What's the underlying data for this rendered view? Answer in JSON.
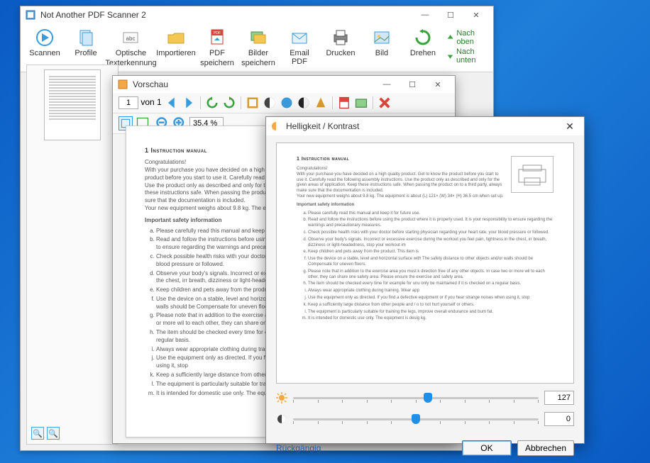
{
  "app": {
    "title": "Not Another PDF Scanner 2",
    "window_buttons": {
      "minimize": "—",
      "maximize": "☐",
      "close": "✕"
    }
  },
  "toolbar": {
    "scan": "Scannen",
    "profiles": "Profile",
    "ocr_line1": "Optische",
    "ocr_line2": "Texterkennung",
    "import": "Importieren",
    "pdf_line1": "PDF",
    "pdf_line2": "speichern",
    "images_line1": "Bilder",
    "images_line2": "speichern",
    "email_pdf": "Email PDF",
    "print": "Drucken",
    "picture": "Bild",
    "rotate": "Drehen",
    "move_up": "Nach oben",
    "move_down": "Nach unten"
  },
  "preview": {
    "title": "Vorschau",
    "page_current": "1",
    "page_of_label": "von 1",
    "zoom_value": "35,4 %"
  },
  "document": {
    "heading": "1   Instruction manual",
    "congrats": "Congratulations!",
    "intro1": "With your purchase you have decided on a high quality product. Get to know the product before you start to use it. Carefully read the following assembly instructions. Use the product only as described and only for the given areas of application. Keep these instructions safe. When passing the product on to a third party, always make sure that the documentation is included.",
    "intro2": "Your new equipment weighs about 9.8 kg. The equipment is about (L) 121× (W) 34× (H) 36.5 cm when set up.",
    "safety_heading": "Important safety information",
    "items": [
      "Please carefully read this manual and keep it for future use.",
      "Read and follow the instructions before using the product where it is properly used. It is your responsibility to ensure regarding the warnings and precautionary measures.",
      "Check possible health risks with your doctor before starting physician regarding your heart rate, your blood pressure or followed.",
      "Observe your body's signals. Incorrect or excessive exercise during the workout you feel pain, tightness in the chest, irr breath, dizziness or light-headedness, stop your workout im",
      "Keep children and pets away from the product. This item is",
      "Use the device on a stable, level and horizontal surface with The safety distance to other objects and/or walls should be Compensate for uneven floors.",
      "Please note that in addition to the exercise area you must k direction free of any other objects. In case two or more wil to each other, they can share one safety area. Please ensure the exercise and safety area.",
      "The item should be checked every time for example for unu only be maintained if it is checked on a regular basis.",
      "Always wear appropriate clothing during training. Wear app",
      "Use the equipment only as directed. If you find a defective equipment or if you hear strange noises when using it, stop",
      "Keep a sufficiently large distance from other people and / o to not hurt yourself or others.",
      "The equipment is particularly suitable for training the legs, improve overall endurance and burn fat.",
      "It is intended for domestic use only. The equipment is desig kg."
    ]
  },
  "dialog": {
    "title": "Helligkeit / Kontrast",
    "close_icon": "✕",
    "brightness_value": "127",
    "contrast_value": "0",
    "revert": "Rückgängig",
    "ok": "OK",
    "cancel": "Abbrechen"
  }
}
